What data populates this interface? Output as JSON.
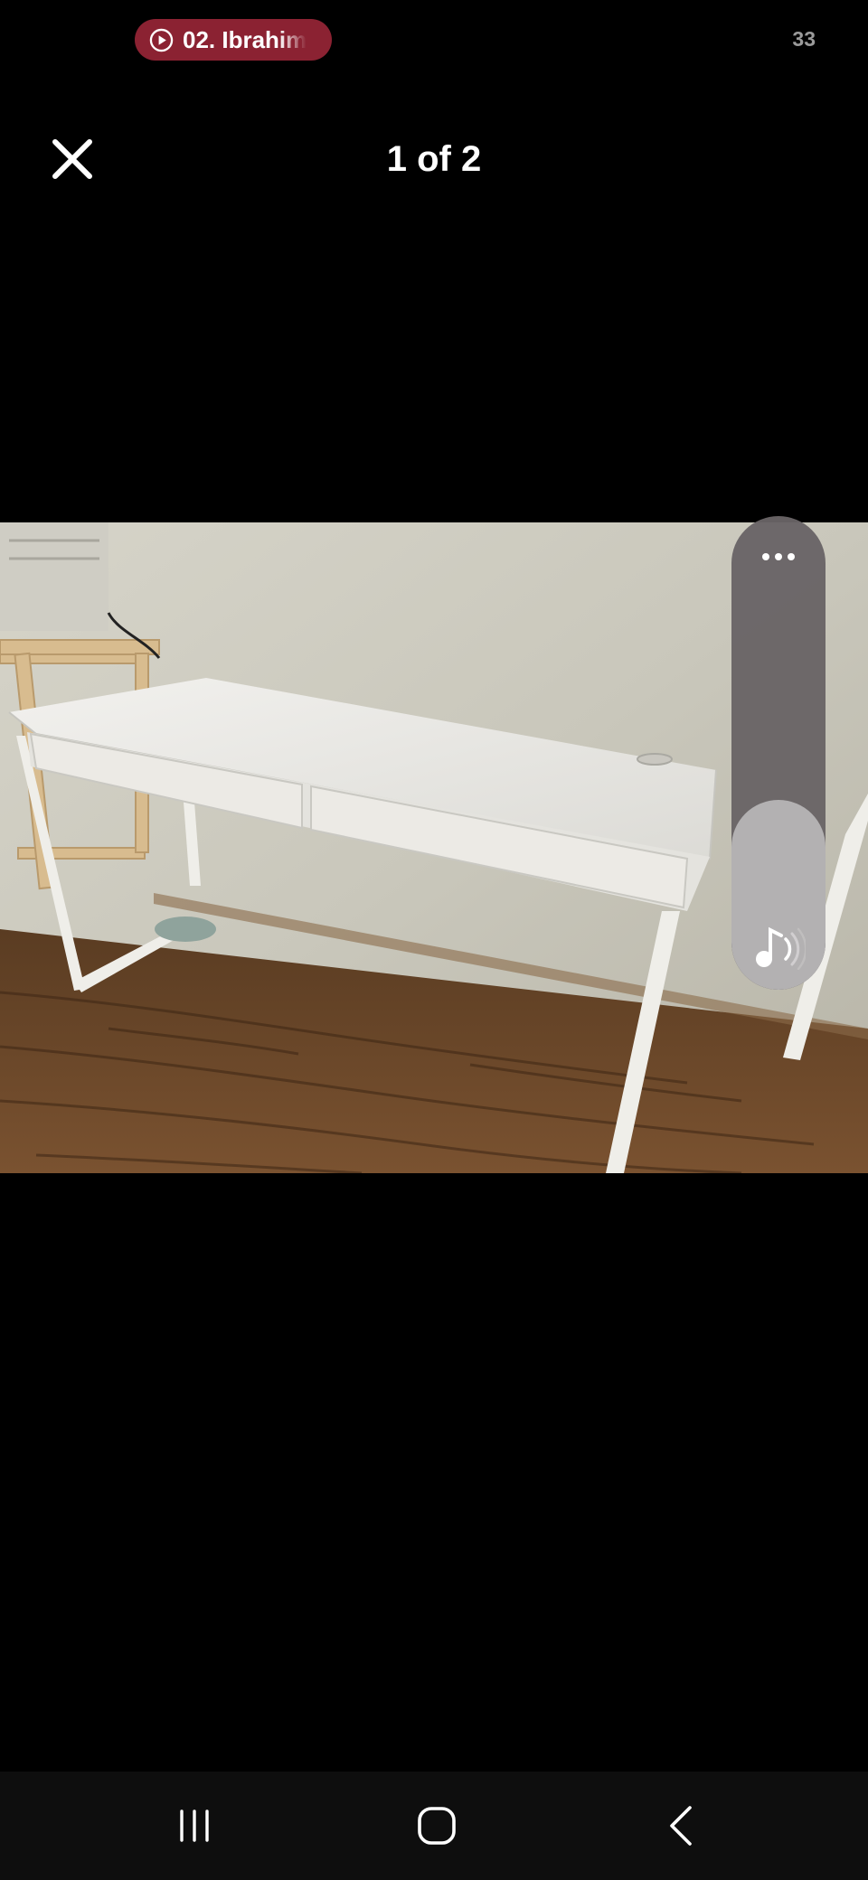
{
  "status_bar": {
    "media_title": "02. Ibrahim",
    "count": "33"
  },
  "viewer": {
    "counter": "1 of 2"
  },
  "volume_panel": {
    "level_fraction": 0.4
  },
  "icons": {
    "play": "play-circle-icon",
    "close": "close-icon",
    "more": "more-horizontal-icon",
    "music_volume": "music-volume-icon",
    "recent": "recent-apps-icon",
    "home": "home-icon",
    "back": "back-icon"
  },
  "colors": {
    "media_pill": "#8b2232",
    "background": "#000000",
    "panel": "#69646a",
    "panel_fill": "#b3b1b2"
  }
}
